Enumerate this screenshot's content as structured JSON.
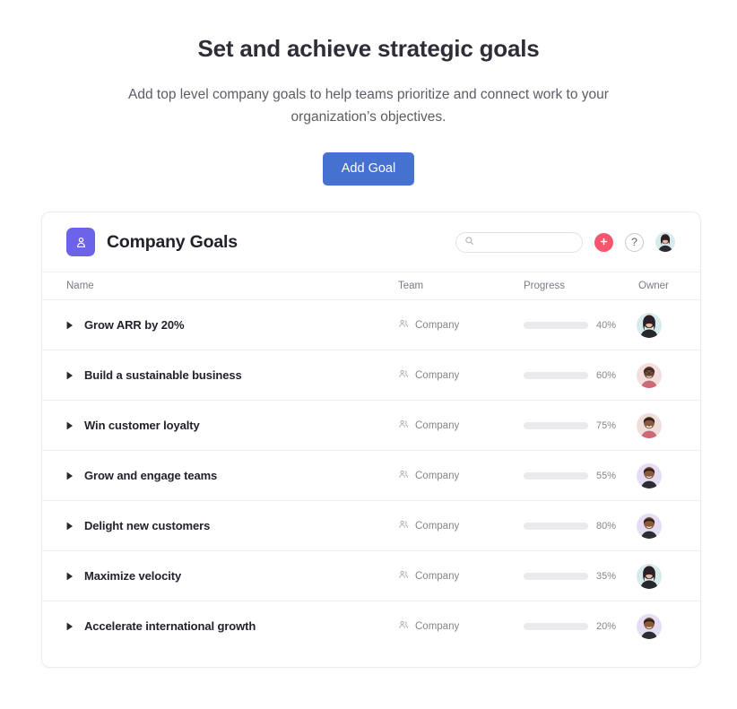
{
  "hero": {
    "title": "Set and achieve strategic goals",
    "subtitle": "Add top level company goals to help teams prioritize and connect work to your organization’s objectives.",
    "cta_label": "Add Goal"
  },
  "card": {
    "brand_title": "Company Goals",
    "brand_icon": "goal-person-icon",
    "brand_icon_color": "#6c63e8",
    "search": {
      "value": "",
      "placeholder": "",
      "icon": "search-icon"
    },
    "add_button": {
      "icon": "plus-icon",
      "color": "#f8566c"
    },
    "help_button": {
      "label": "?"
    },
    "account_avatar": "avatar-woman-dark-hair"
  },
  "table": {
    "columns": [
      "Name",
      "Team",
      "Progress",
      "Owner"
    ],
    "rows": [
      {
        "caret": "triangle-right-icon",
        "name": "Grow ARR by 20%",
        "team_icon": "people-icon",
        "team": "Company",
        "progress": 40,
        "progress_label": "40%",
        "progress_color": "#14c4a0",
        "owner_avatar": "avatar-woman-dark-hair",
        "avatar_bg": "#d7eaec"
      },
      {
        "caret": "triangle-right-icon",
        "name": "Build a sustainable business",
        "team_icon": "people-icon",
        "team": "Company",
        "progress": 60,
        "progress_label": "60%",
        "progress_color": "#f0a317",
        "owner_avatar": "avatar-man-glasses",
        "avatar_bg": "#f3dfe0"
      },
      {
        "caret": "triangle-right-icon",
        "name": "Win customer loyalty",
        "team_icon": "people-icon",
        "team": "Company",
        "progress": 75,
        "progress_label": "75%",
        "progress_color": "#14c4a0",
        "owner_avatar": "avatar-man-smiling",
        "avatar_bg": "#f0dedd"
      },
      {
        "caret": "triangle-right-icon",
        "name": "Grow and engage teams",
        "team_icon": "people-icon",
        "team": "Company",
        "progress": 55,
        "progress_label": "55%",
        "progress_color": "#14c4a0",
        "owner_avatar": "avatar-man-short-hair",
        "avatar_bg": "#e5ddf3"
      },
      {
        "caret": "triangle-right-icon",
        "name": "Delight new customers",
        "team_icon": "people-icon",
        "team": "Company",
        "progress": 80,
        "progress_label": "80%",
        "progress_color": "#f0a317",
        "owner_avatar": "avatar-man-short-hair",
        "avatar_bg": "#e5ddf3"
      },
      {
        "caret": "triangle-right-icon",
        "name": "Maximize velocity",
        "team_icon": "people-icon",
        "team": "Company",
        "progress": 35,
        "progress_label": "35%",
        "progress_color": "#ef4c63",
        "owner_avatar": "avatar-woman-dark-hair",
        "avatar_bg": "#d7eaec"
      },
      {
        "caret": "triangle-right-icon",
        "name": "Accelerate international growth",
        "team_icon": "people-icon",
        "team": "Company",
        "progress": 20,
        "progress_label": "20%",
        "progress_color": "#14c4a0",
        "owner_avatar": "avatar-man-short-hair",
        "avatar_bg": "#e5ddf3"
      }
    ]
  }
}
